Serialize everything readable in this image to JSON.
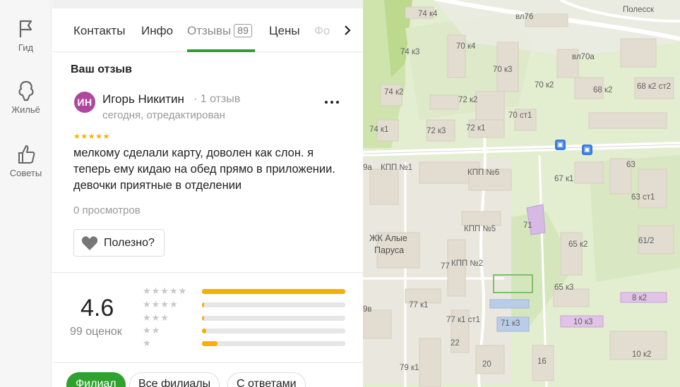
{
  "rail": {
    "items": [
      {
        "label": "Гид"
      },
      {
        "label": "Жильё"
      },
      {
        "label": "Советы"
      }
    ]
  },
  "tabs": {
    "contacts": "Контакты",
    "info": "Инфо",
    "reviews": "Отзывы",
    "reviews_count": "89",
    "prices": "Цены",
    "photos": "Фо"
  },
  "review": {
    "section_title": "Ваш отзыв",
    "avatar_initials": "ИН",
    "author": "Игорь Никитин",
    "author_reviews": "· 1 отзыв",
    "date": "сегодня, отредактирован",
    "stars": "★★★★★",
    "rating": 5,
    "text": "мелкому сделали карту, доволен как слон. я теперь ему кидаю на обед прямо в приложении. девочки приятные в отделении",
    "views": "0 просмотров",
    "useful_label": "Полезно?"
  },
  "summary": {
    "rating": "4.6",
    "count": "99 оценок",
    "distribution": [
      {
        "stars": "★★★★★",
        "fraction": 1.0
      },
      {
        "stars": "★★★★",
        "fraction": 0.01
      },
      {
        "stars": "★★★",
        "fraction": 0.01
      },
      {
        "stars": "★★",
        "fraction": 0.03
      },
      {
        "stars": "★",
        "fraction": 0.11
      }
    ]
  },
  "filters": {
    "branch": "Филиал",
    "all_branches": "Все филиалы",
    "with_answers": "С ответами"
  },
  "map": {
    "labels": [
      "74 к4",
      "вл76",
      "Полесск",
      "70 к4",
      "74 к3",
      "вл70а",
      "70 к3",
      "70 к2",
      "68 к2",
      "68 к2 ст2",
      "74 к2",
      "72 к2",
      "70 ст1",
      "74 к1",
      "72 к3",
      "72 к1",
      "9а",
      "КПП №1",
      "КПП №6",
      "63",
      "67 к1",
      "63 ст1",
      "КПП №5",
      "71",
      "ЖК Алые",
      "Паруса",
      "65 к2",
      "61/2",
      "77",
      "КПП №2",
      "65 к3",
      "8 к2",
      "77 к1",
      "77 к1 ст1",
      "71 к3",
      "10 к3",
      "9в",
      "22",
      "79 к1",
      "20",
      "16",
      "10 к2"
    ]
  },
  "colors": {
    "accent_green": "#2ea12e",
    "star_yellow": "#f6b100",
    "avatar_purple": "#b046a0"
  }
}
